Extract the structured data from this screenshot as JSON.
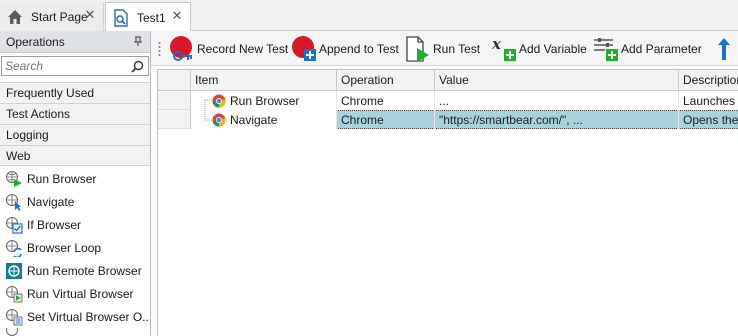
{
  "tabs": [
    {
      "label": "Start Page",
      "icon": "home-icon"
    },
    {
      "label": "Test1",
      "icon": "test-file-icon"
    }
  ],
  "operations_panel": {
    "title": "Operations",
    "search_placeholder": "Search",
    "categories": [
      "Frequently Used",
      "Test Actions",
      "Logging",
      "Web"
    ],
    "items": [
      {
        "label": "Run Browser",
        "icon": "run-browser-icon"
      },
      {
        "label": "Navigate",
        "icon": "navigate-icon"
      },
      {
        "label": "If Browser",
        "icon": "if-browser-icon"
      },
      {
        "label": "Browser Loop",
        "icon": "browser-loop-icon"
      },
      {
        "label": "Run Remote Browser",
        "icon": "run-remote-browser-icon"
      },
      {
        "label": "Run Virtual Browser",
        "icon": "run-virtual-browser-icon"
      },
      {
        "label": "Set Virtual Browser O...",
        "icon": "set-virtual-browser-icon"
      }
    ]
  },
  "toolbar": {
    "record": "Record New Test",
    "append": "Append to Test",
    "run": "Run Test",
    "add_variable": "Add Variable",
    "add_parameter": "Add Parameter"
  },
  "grid": {
    "columns": [
      "Item",
      "Operation",
      "Value",
      "Description"
    ],
    "rows": [
      {
        "item": "Run Browser",
        "operation": "Chrome",
        "value": "...",
        "description": "Launches th"
      },
      {
        "item": "Navigate",
        "operation": "Chrome",
        "value": "\"https://smartbear.com/\", ...",
        "description": "Opens the s"
      }
    ]
  },
  "colors": {
    "record_red": "#d7182a",
    "add_green": "#1fae2f",
    "selection": "#a7d3de",
    "header_bg": "#dfe3e8"
  }
}
